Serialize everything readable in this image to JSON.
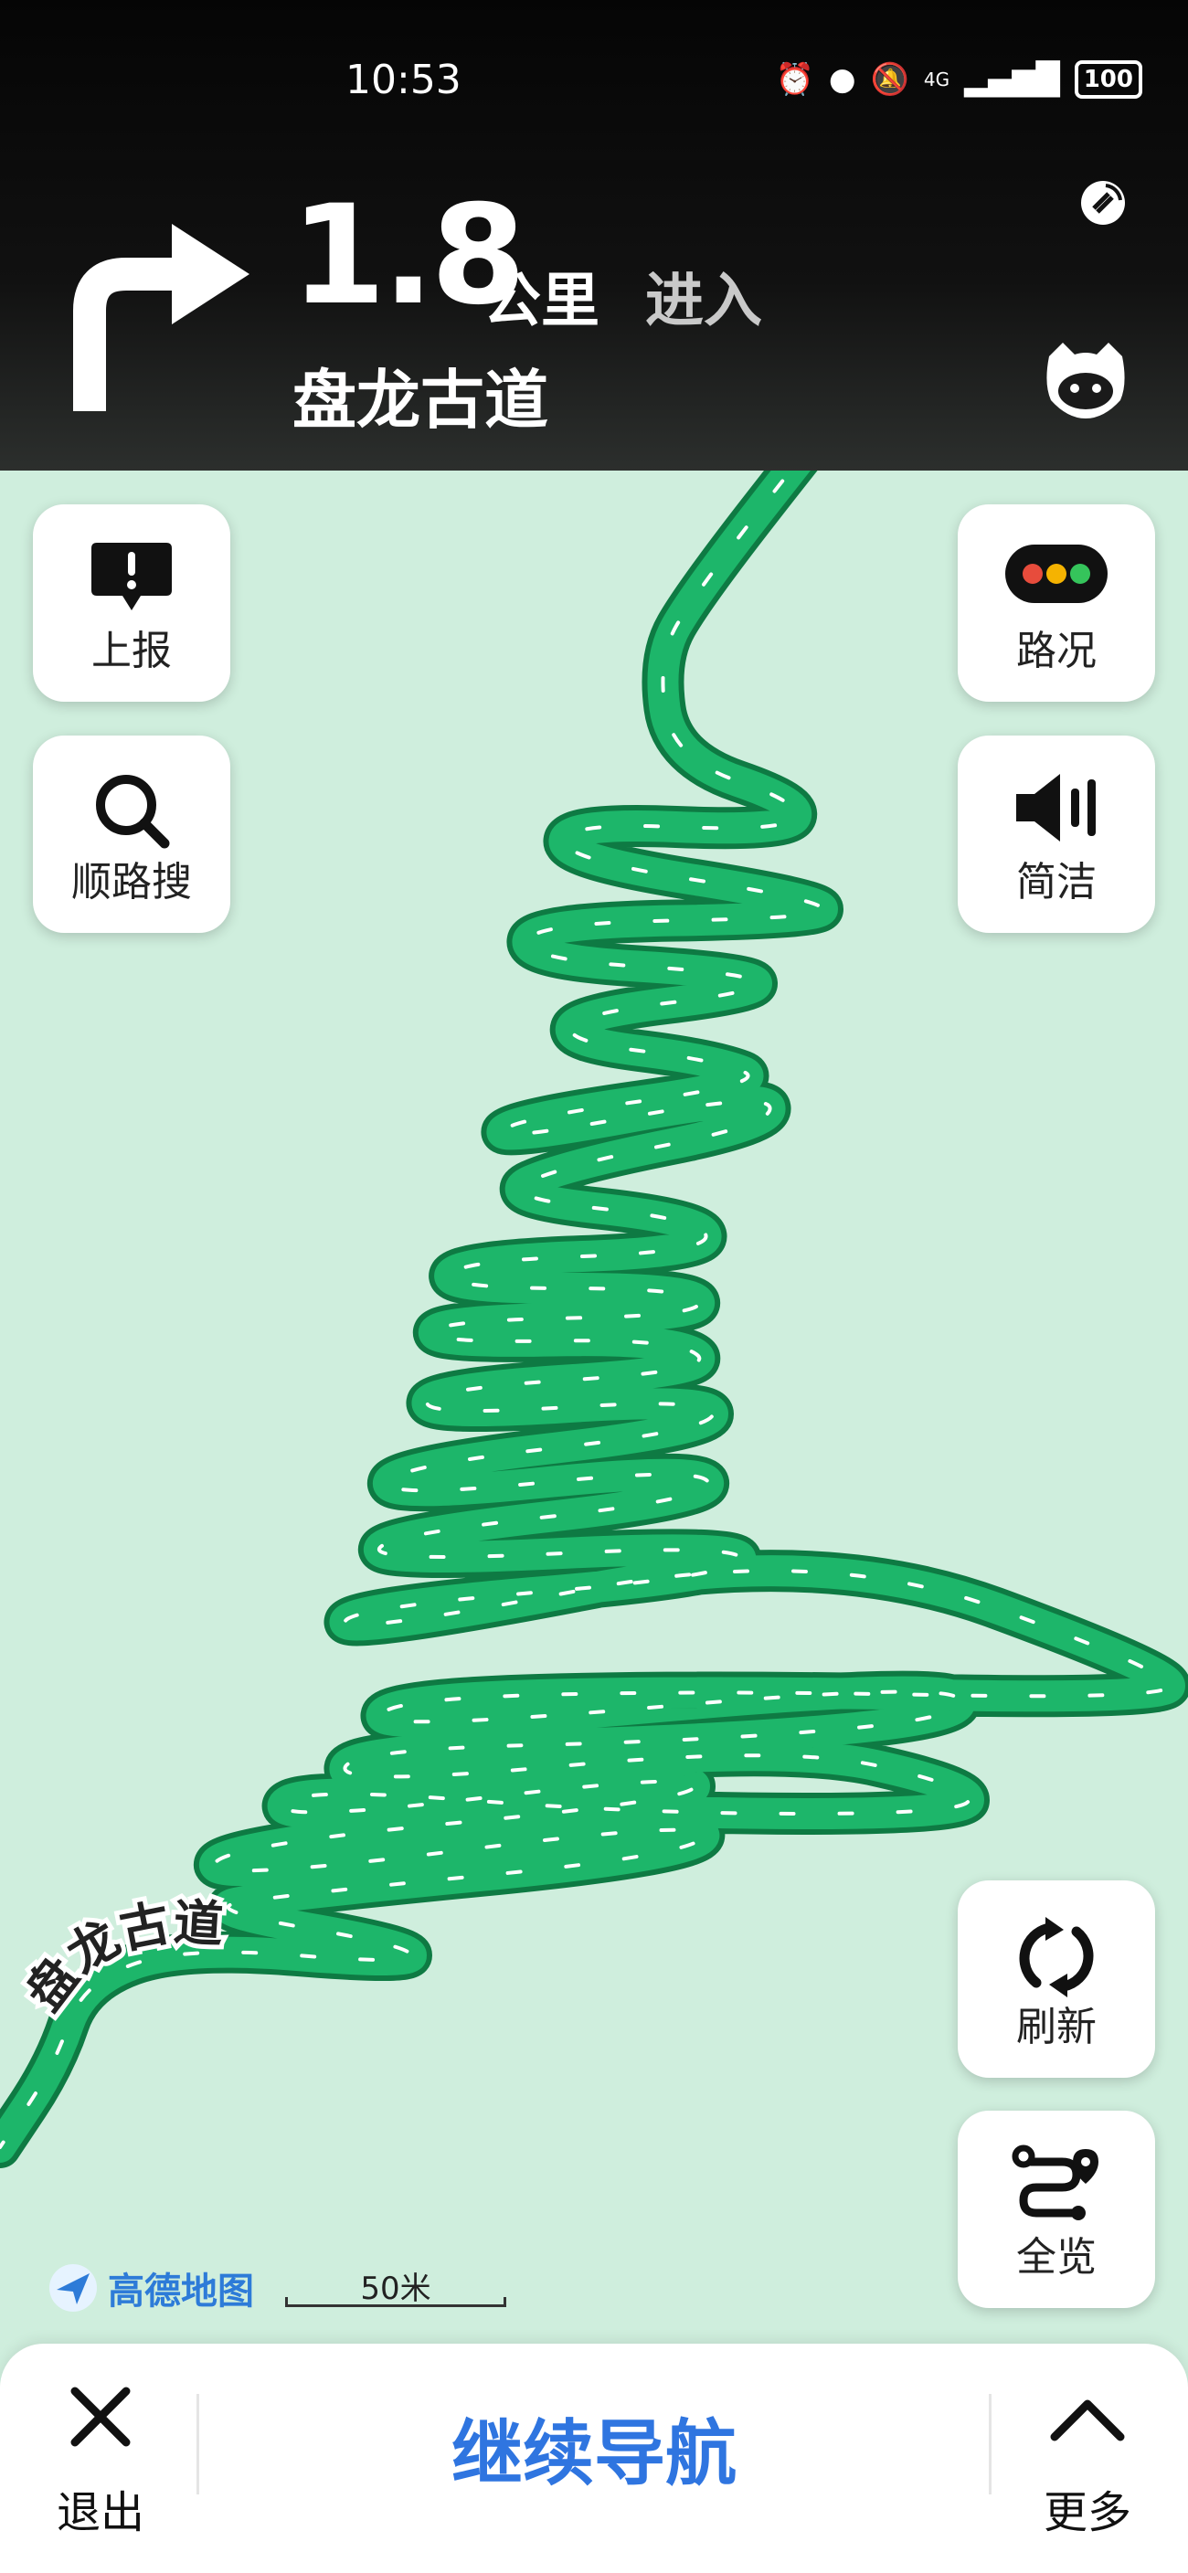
{
  "status_bar": {
    "time": "10:53",
    "network": "4G",
    "battery": "100"
  },
  "guidance": {
    "distance": "1.8",
    "unit": "公里",
    "action": "进入",
    "road": "盘龙古道"
  },
  "left_buttons": [
    {
      "label": "上报",
      "icon": "report-icon"
    },
    {
      "label": "顺路搜",
      "icon": "search-icon"
    }
  ],
  "right_buttons": [
    {
      "label": "路况",
      "icon": "traffic-icon"
    },
    {
      "label": "简洁",
      "icon": "volume-icon"
    },
    {
      "label": "刷新",
      "icon": "refresh-icon"
    },
    {
      "label": "全览",
      "icon": "overview-icon"
    }
  ],
  "map": {
    "road_label": "盘龙古道",
    "logo": "高德地图",
    "scale": "50米",
    "route_color": "#1db66a",
    "route_edge": "#0e7a43",
    "background": "#cfeedd"
  },
  "bottom_bar": {
    "exit_label": "退出",
    "continue_label": "继续导航",
    "more_label": "更多"
  }
}
